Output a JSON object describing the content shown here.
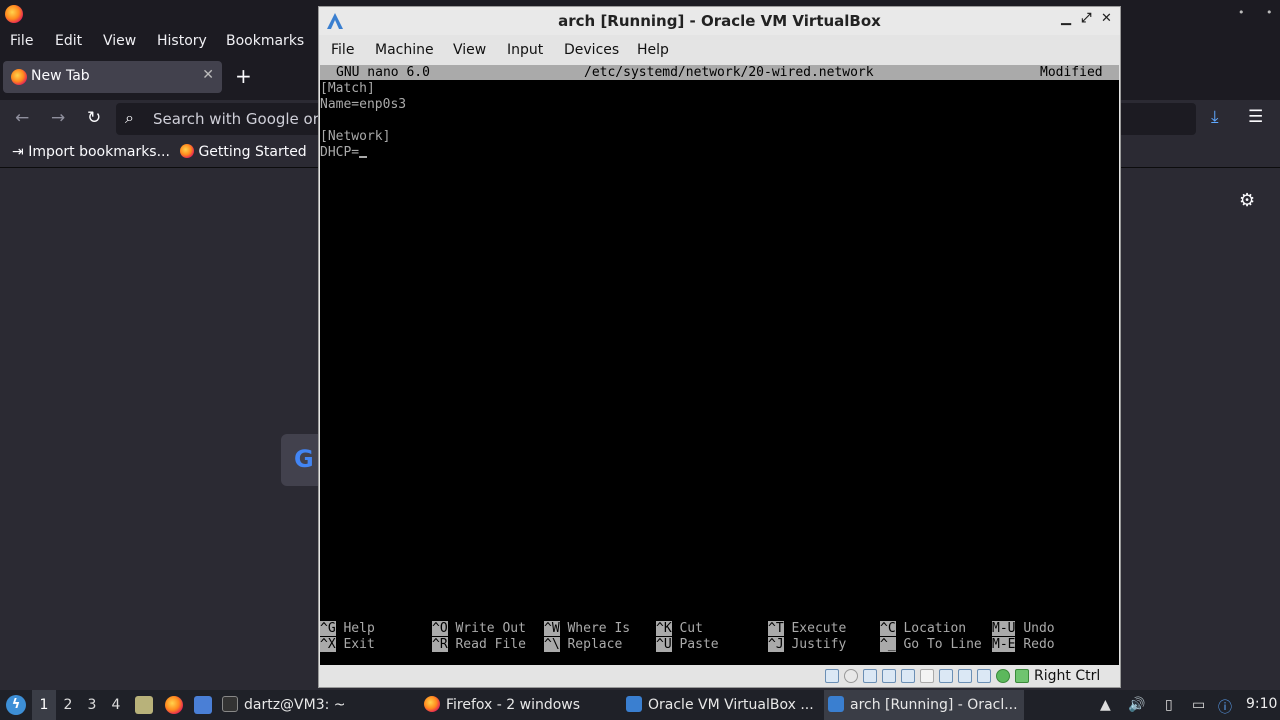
{
  "firefox": {
    "menu": [
      "File",
      "Edit",
      "View",
      "History",
      "Bookmarks"
    ],
    "tab_label": "New Tab",
    "url_placeholder": "Search with Google or e",
    "bookmarks": [
      "Import bookmarks...",
      "Getting Started"
    ]
  },
  "vbox": {
    "title": "arch [Running] - Oracle VM VirtualBox",
    "menu": [
      "File",
      "Machine",
      "View",
      "Input",
      "Devices",
      "Help"
    ],
    "nano": {
      "version": "GNU nano 6.0",
      "file": "/etc/systemd/network/20-wired.network",
      "state": "Modified",
      "lines": [
        "[Match]",
        "Name=enp0s3",
        "",
        "[Network]",
        "DHCP="
      ],
      "shortcuts_row1": [
        {
          "key": "^G",
          "label": "Help"
        },
        {
          "key": "^O",
          "label": "Write Out"
        },
        {
          "key": "^W",
          "label": "Where Is"
        },
        {
          "key": "^K",
          "label": "Cut"
        },
        {
          "key": "^T",
          "label": "Execute"
        },
        {
          "key": "^C",
          "label": "Location"
        },
        {
          "key": "M-U",
          "label": "Undo"
        }
      ],
      "shortcuts_row2": [
        {
          "key": "^X",
          "label": "Exit"
        },
        {
          "key": "^R",
          "label": "Read File"
        },
        {
          "key": "^\\",
          "label": "Replace"
        },
        {
          "key": "^U",
          "label": "Paste"
        },
        {
          "key": "^J",
          "label": "Justify"
        },
        {
          "key": "^_",
          "label": "Go To Line"
        },
        {
          "key": "M-E",
          "label": "Redo"
        }
      ]
    },
    "host_key": "Right Ctrl"
  },
  "taskbar": {
    "workspaces": [
      "1",
      "2",
      "3",
      "4"
    ],
    "tasks": [
      "dartz@VM3: ~",
      "Firefox - 2 windows",
      "Oracle VM VirtualBox ...",
      "arch [Running] - Oracl..."
    ],
    "clock": "9:10"
  },
  "colors": {
    "firefox_bg": "#2b2a33",
    "firefox_toolbar": "#1c1b22",
    "terminal_fg": "#aaaaaa",
    "taskbar": "#1f2128",
    "accent_blue": "#5fa8ff"
  }
}
